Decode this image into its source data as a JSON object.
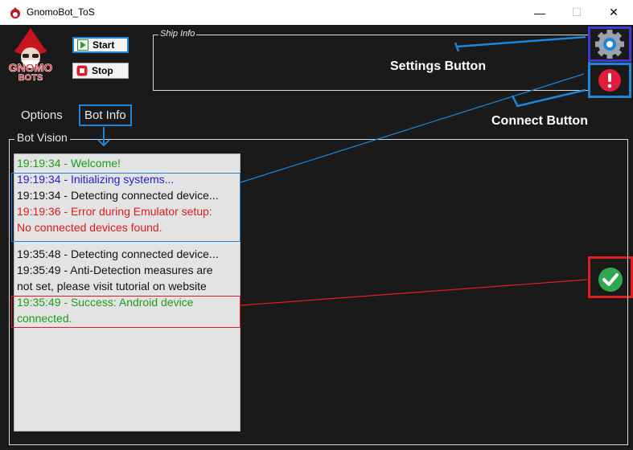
{
  "window": {
    "title": "GnomoBot_ToS",
    "controls": {
      "minimize": "—",
      "maximize": "☐",
      "close": "✕"
    }
  },
  "toolbar": {
    "start_label": "Start",
    "stop_label": "Stop"
  },
  "ship_info": {
    "legend": "Ship Info"
  },
  "annotations": {
    "settings_button": "Settings Button",
    "connect_button": "Connect Button"
  },
  "tabs": [
    {
      "label": "Options",
      "selected": false
    },
    {
      "label": "Bot Info",
      "selected": true
    }
  ],
  "bot_vision": {
    "legend": "Bot Vision",
    "log_lines": [
      {
        "text": "19:19:34 - Welcome!",
        "color": "green"
      },
      {
        "text": "19:19:34 - Initializing systems...",
        "color": "blue"
      },
      {
        "text": "19:19:34 - Detecting connected device...",
        "color": "black"
      },
      {
        "text": "19:19:36 - Error during Emulator setup:",
        "color": "red"
      },
      {
        "text": "No connected devices found.",
        "color": "red"
      },
      {
        "text": "19:35:48 - Detecting connected device...",
        "color": "black"
      },
      {
        "text": "19:35:49 - Anti-Detection measures are",
        "color": "black"
      },
      {
        "text": "not set, please visit tutorial on website",
        "color": "black"
      },
      {
        "text": "19:35:49 - Success: Android device",
        "color": "green"
      },
      {
        "text": "connected.",
        "color": "green"
      }
    ]
  },
  "logo": {
    "line1": "GNOMO",
    "line2": "BOTS"
  },
  "colors": {
    "background": "#1a1a1a",
    "accent_blue": "#1e86d8",
    "annotation_red": "#e11c24",
    "log_green": "#1a9e1a",
    "log_blue": "#1d1de0",
    "log_red": "#e01a1a"
  }
}
